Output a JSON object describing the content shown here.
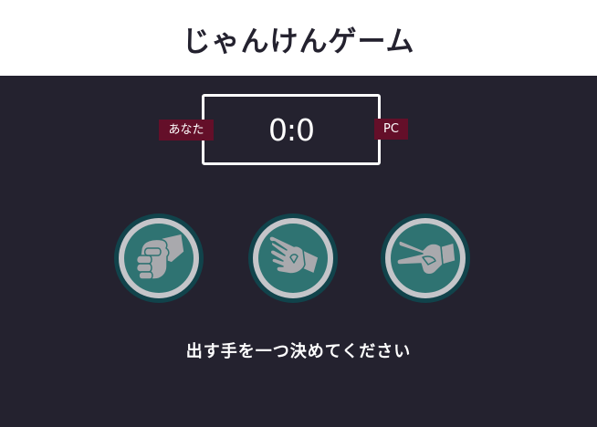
{
  "header": {
    "title": "じゃんけんゲーム"
  },
  "scoreboard": {
    "score": "0:0",
    "user_label": "あなた",
    "pc_label": "PC"
  },
  "choices": [
    {
      "name": "rock",
      "icon": "rock-hand-icon"
    },
    {
      "name": "paper",
      "icon": "paper-hand-icon"
    },
    {
      "name": "scissors",
      "icon": "scissors-hand-icon"
    }
  ],
  "message": "出す手を一つ決めてください",
  "colors": {
    "background": "#24222f",
    "header": "#ffffff",
    "badge": "#640f29",
    "choice_outer": "#11434b",
    "choice_ring": "#c5c5c9",
    "choice_fill": "#2f7372",
    "hand": "#a9a9ad"
  }
}
